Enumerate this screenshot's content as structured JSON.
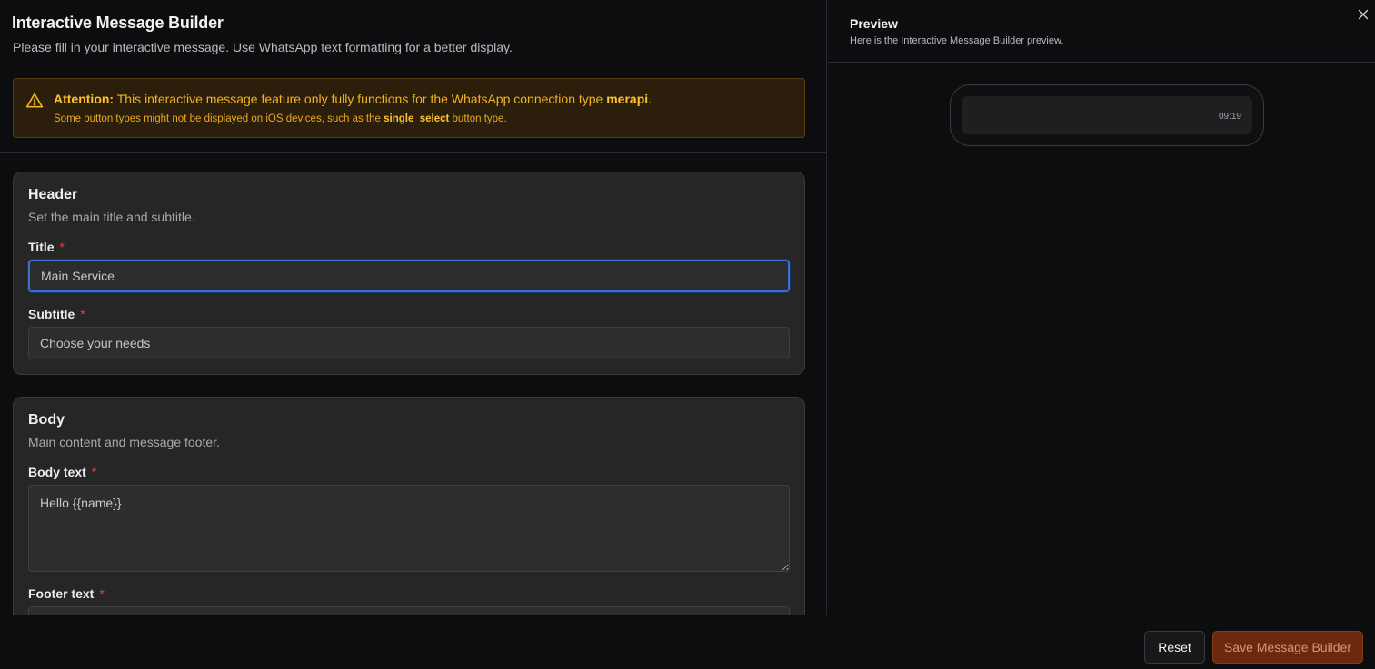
{
  "builder": {
    "title": "Interactive Message Builder",
    "description": "Please fill in your interactive message. Use WhatsApp text formatting for a better display."
  },
  "alert": {
    "label": "Attention:",
    "line1_text": " This interactive message feature only fully functions for the WhatsApp connection type ",
    "connection_type": "merapi",
    "line1_end": ".",
    "line2_text": "Some button types might not be displayed on iOS devices, such as the ",
    "button_type": "single_select",
    "line2_end": " button type.",
    "icon": "warning-triangle-icon",
    "color": "#f3b324"
  },
  "header_section": {
    "title": "Header",
    "subtitle": "Set the main title and subtitle.",
    "title_field": {
      "label": "Title",
      "required": "*",
      "value": "Main Service"
    },
    "subtitle_field": {
      "label": "Subtitle",
      "required": "*",
      "value": "Choose your needs"
    }
  },
  "body_section": {
    "title": "Body",
    "subtitle": "Main content and message footer.",
    "body_field": {
      "label": "Body text",
      "required": "*",
      "value": "Hello {{name}}"
    },
    "footer_field": {
      "label": "Footer text",
      "required": "*",
      "value": ""
    }
  },
  "preview": {
    "title": "Preview",
    "description": "Here is the Interactive Message Builder preview.",
    "message_time": "09:19"
  },
  "actions": {
    "reset_label": "Reset",
    "save_label": "Save Message Builder",
    "save_color": "#6b2a0e"
  },
  "colors": {
    "background": "#0c0d0f",
    "card": "#262626",
    "focus": "#3e6fcf",
    "required": "#e0443a"
  }
}
